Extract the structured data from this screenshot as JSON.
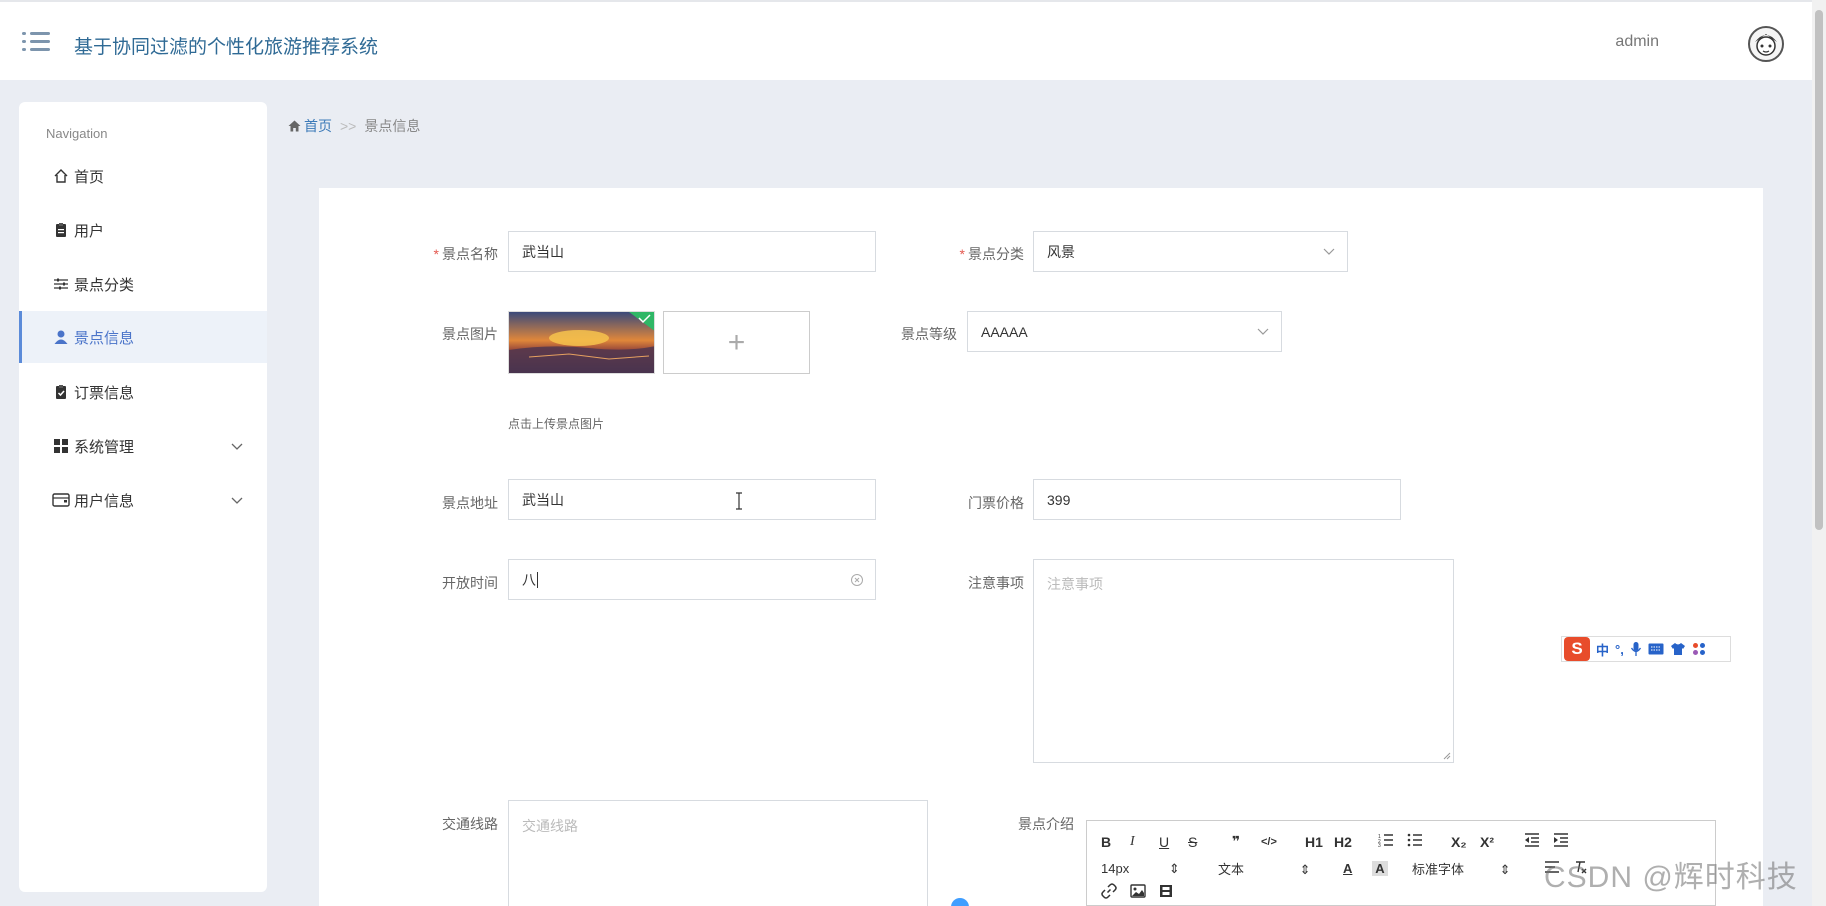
{
  "header": {
    "app_title": "基于协同过滤的个性化旅游推荐系统",
    "username": "admin"
  },
  "sidebar": {
    "heading": "Navigation",
    "items": [
      {
        "label": "首页",
        "icon": "home-icon"
      },
      {
        "label": "用户",
        "icon": "clipboard-icon"
      },
      {
        "label": "景点分类",
        "icon": "sliders-icon"
      },
      {
        "label": "景点信息",
        "icon": "user-icon",
        "active": true
      },
      {
        "label": "订票信息",
        "icon": "clipboard-check-icon"
      },
      {
        "label": "系统管理",
        "icon": "grid-icon",
        "expandable": true
      },
      {
        "label": "用户信息",
        "icon": "wallet-icon",
        "expandable": true
      }
    ]
  },
  "breadcrumb": {
    "home": "首页",
    "separator": ">>",
    "current": "景点信息"
  },
  "form": {
    "name": {
      "label": "景点名称",
      "value": "武当山",
      "required": true
    },
    "category": {
      "label": "景点分类",
      "value": "风景",
      "required": true
    },
    "image": {
      "label": "景点图片",
      "upload_hint": "点击上传景点图片",
      "add_symbol": "+"
    },
    "level": {
      "label": "景点等级",
      "value": "AAAAA"
    },
    "address": {
      "label": "景点地址",
      "value": "武当山"
    },
    "price": {
      "label": "门票价格",
      "value": "399"
    },
    "open_time": {
      "label": "开放时间",
      "value": "八"
    },
    "notice": {
      "label": "注意事项",
      "placeholder": "注意事项"
    },
    "traffic": {
      "label": "交通线路",
      "placeholder": "交通线路"
    },
    "intro": {
      "label": "景点介绍"
    }
  },
  "editor_toolbar": {
    "row1": [
      "B",
      "I",
      "U",
      "S",
      "❞",
      "</>",
      "H1",
      "H2",
      "ordered-list",
      "bullet-list",
      "X₂",
      "X²",
      "outdent",
      "indent"
    ],
    "font_size": "14px",
    "header_select": "文本",
    "font_family": "标准字体"
  },
  "ime_toolbar": {
    "lang": "中"
  },
  "watermark": "CSDN @辉时科技",
  "colors": {
    "accent": "#4a74c9",
    "title": "#2f6a95",
    "required": "#e4584f",
    "background": "#eaedf3"
  }
}
